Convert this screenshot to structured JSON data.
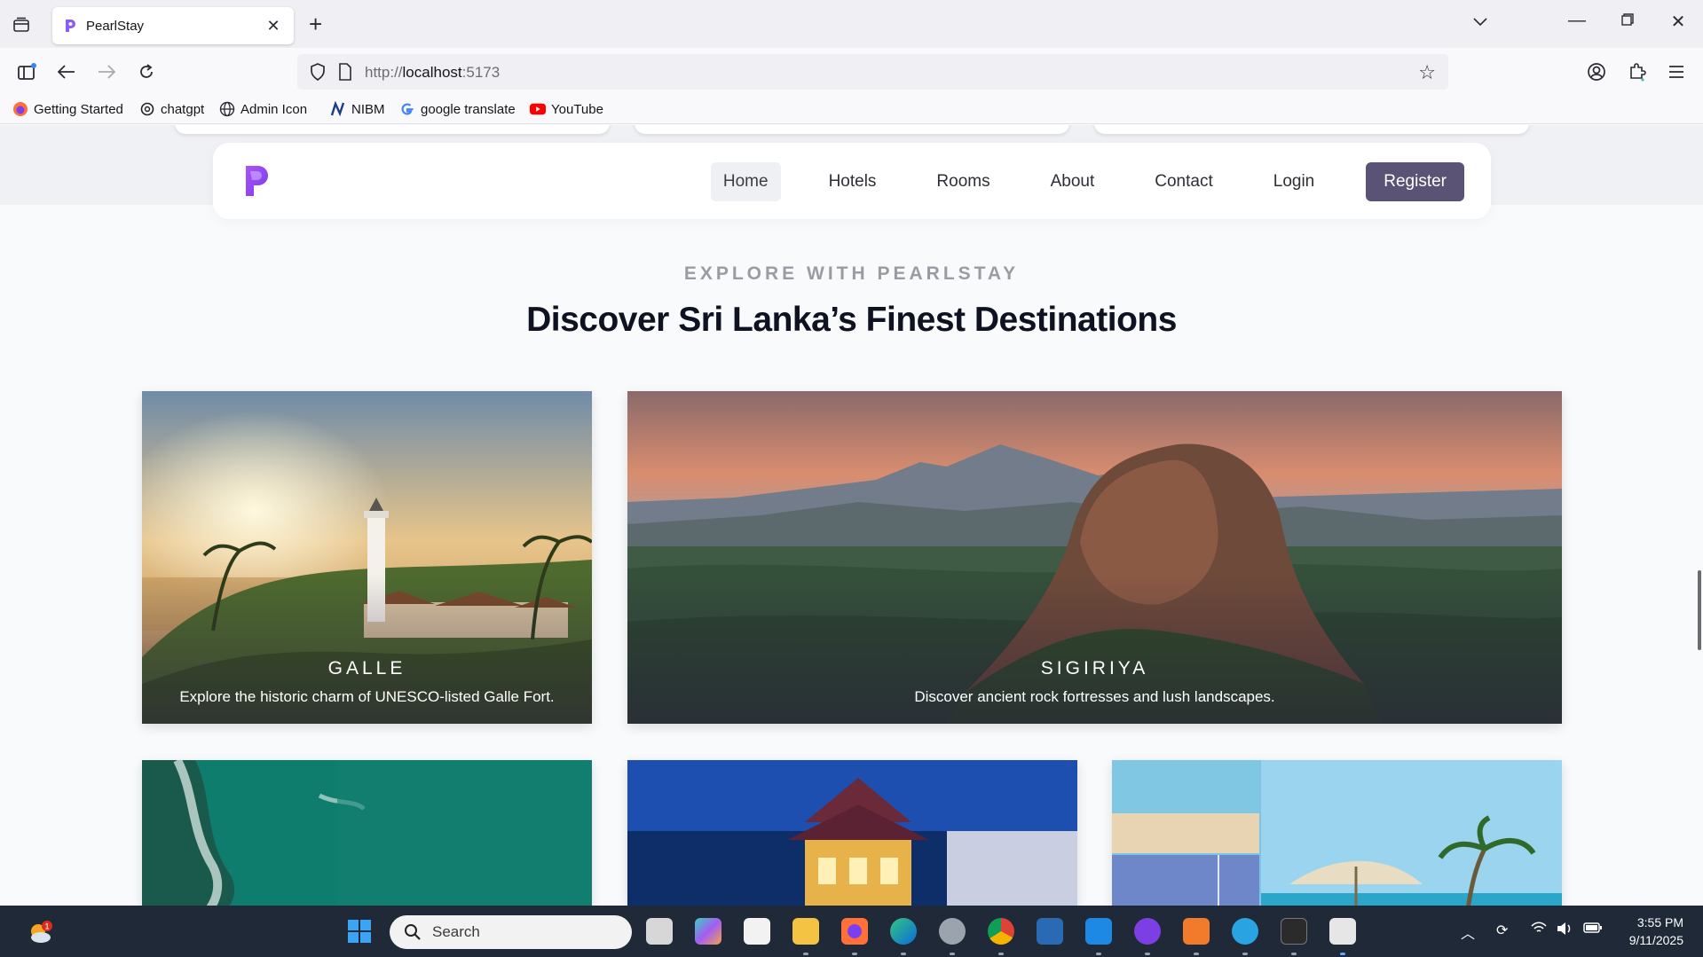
{
  "browser": {
    "tab_title": "PearlStay",
    "url_scheme": "http://",
    "url_host": "localhost",
    "url_port": ":5173",
    "bookmarks": [
      "Getting Started",
      "chatgpt",
      "Admin Icon",
      "NIBM",
      "google translate",
      "YouTube"
    ]
  },
  "nav": {
    "items": [
      "Home",
      "Hotels",
      "Rooms",
      "About",
      "Contact",
      "Login"
    ],
    "cta": "Register",
    "active": "Home",
    "cta_color": "#5b5376"
  },
  "section": {
    "eyebrow": "EXPLORE WITH PEARLSTAY",
    "title": "Discover Sri Lanka’s Finest Destinations"
  },
  "destinations": [
    {
      "name": "GALLE",
      "description": "Explore the historic charm of UNESCO-listed Galle Fort."
    },
    {
      "name": "SIGIRIYA",
      "description": "Discover ancient rock fortresses and lush landscapes."
    }
  ],
  "taskbar": {
    "search_placeholder": "Search",
    "time": "3:55 PM",
    "date": "9/11/2025",
    "weather_badge": "1"
  }
}
